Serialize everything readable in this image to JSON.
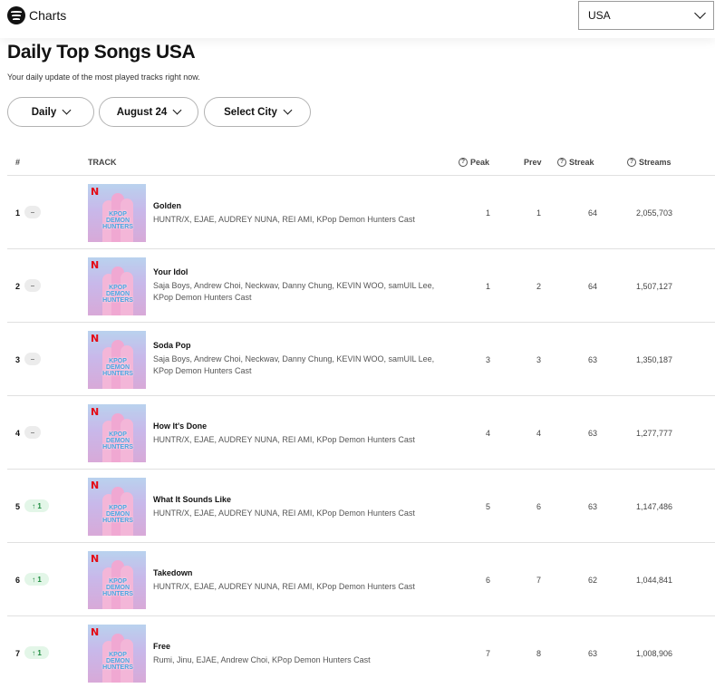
{
  "header": {
    "logo_text": "Charts",
    "country_select": "USA"
  },
  "title": "Daily Top Songs USA",
  "subtitle": "Your daily update of the most played tracks right now.",
  "filters": {
    "frequency": "Daily",
    "date": "August 24",
    "city": "Select City"
  },
  "columns": {
    "rank": "#",
    "track": "TRACK",
    "peak": "Peak",
    "prev": "Prev",
    "streak": "Streak",
    "streams": "Streams"
  },
  "album_art": {
    "badge_letter": "N",
    "title": "KPOP DEMON HUNTERS"
  },
  "rows": [
    {
      "rank": "1",
      "change": "–",
      "trend": "same",
      "name": "Golden",
      "artists": "HUNTR/X, EJAE, AUDREY NUNA, REI AMI, KPop Demon Hunters Cast",
      "peak": "1",
      "prev": "1",
      "streak": "64",
      "streams": "2,055,703"
    },
    {
      "rank": "2",
      "change": "–",
      "trend": "same",
      "name": "Your Idol",
      "artists": "Saja Boys, Andrew Choi, Neckwav, Danny Chung, KEVIN WOO, samUIL Lee, KPop Demon Hunters Cast",
      "peak": "1",
      "prev": "2",
      "streak": "64",
      "streams": "1,507,127"
    },
    {
      "rank": "3",
      "change": "–",
      "trend": "same",
      "name": "Soda Pop",
      "artists": "Saja Boys, Andrew Choi, Neckwav, Danny Chung, KEVIN WOO, samUIL Lee, KPop Demon Hunters Cast",
      "peak": "3",
      "prev": "3",
      "streak": "63",
      "streams": "1,350,187"
    },
    {
      "rank": "4",
      "change": "–",
      "trend": "same",
      "name": "How It's Done",
      "artists": "HUNTR/X, EJAE, AUDREY NUNA, REI AMI, KPop Demon Hunters Cast",
      "peak": "4",
      "prev": "4",
      "streak": "63",
      "streams": "1,277,777"
    },
    {
      "rank": "5",
      "change": "↑ 1",
      "trend": "up",
      "name": "What It Sounds Like",
      "artists": "HUNTR/X, EJAE, AUDREY NUNA, REI AMI, KPop Demon Hunters Cast",
      "peak": "5",
      "prev": "6",
      "streak": "63",
      "streams": "1,147,486"
    },
    {
      "rank": "6",
      "change": "↑ 1",
      "trend": "up",
      "name": "Takedown",
      "artists": "HUNTR/X, EJAE, AUDREY NUNA, REI AMI, KPop Demon Hunters Cast",
      "peak": "6",
      "prev": "7",
      "streak": "62",
      "streams": "1,044,841"
    },
    {
      "rank": "7",
      "change": "↑ 1",
      "trend": "up",
      "name": "Free",
      "artists": "Rumi, Jinu, EJAE, Andrew Choi, KPop Demon Hunters Cast",
      "peak": "7",
      "prev": "8",
      "streak": "63",
      "streams": "1,008,906"
    }
  ]
}
